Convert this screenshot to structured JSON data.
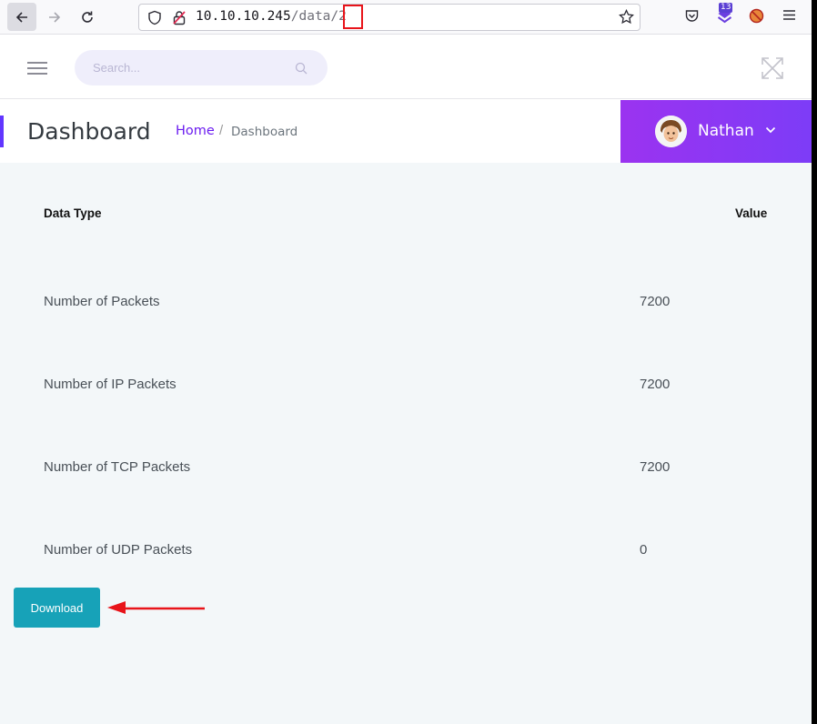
{
  "browser": {
    "url_host": "10.10.10.245",
    "url_path": "/data/",
    "url_id": "2",
    "extension_badge": "13"
  },
  "header": {
    "search_placeholder": "Search..."
  },
  "title_bar": {
    "page_title": "Dashboard",
    "breadcrumb_home": "Home",
    "breadcrumb_separator": "/",
    "breadcrumb_current": "Dashboard",
    "user_name": "Nathan"
  },
  "table": {
    "headers": {
      "type": "Data Type",
      "value": "Value"
    },
    "rows": [
      {
        "label": "Number of Packets",
        "value": "7200"
      },
      {
        "label": "Number of IP Packets",
        "value": "7200"
      },
      {
        "label": "Number of TCP Packets",
        "value": "7200"
      },
      {
        "label": "Number of UDP Packets",
        "value": "0"
      }
    ]
  },
  "actions": {
    "download_label": "Download"
  },
  "colors": {
    "accent": "#6236ff",
    "user_panel": "#8a38f5",
    "download_button": "#17a2b8",
    "annotation_red": "#e8141a"
  }
}
